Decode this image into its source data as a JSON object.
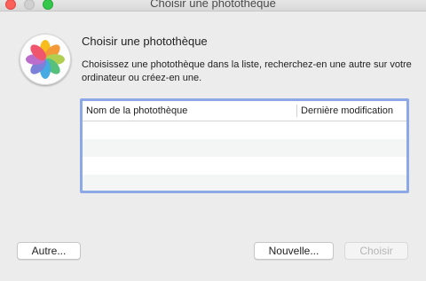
{
  "window": {
    "title": "Choisir une photothèque"
  },
  "dialog": {
    "heading": "Choisir une photothèque",
    "description": "Choisissez une photothèque dans la liste, recherchez-en une autre sur votre ordinateur ou créez-en une.",
    "app_icon": "photos-app-icon"
  },
  "library_list": {
    "columns": [
      "Nom de la photothèque",
      "Dernière modification"
    ],
    "rows": []
  },
  "buttons": {
    "other": "Autre...",
    "new": "Nouvelle...",
    "choose": "Choisir"
  },
  "colors": {
    "focus_ring": "#8da8e6",
    "close": "#fc605b",
    "maximize": "#34c84a"
  }
}
